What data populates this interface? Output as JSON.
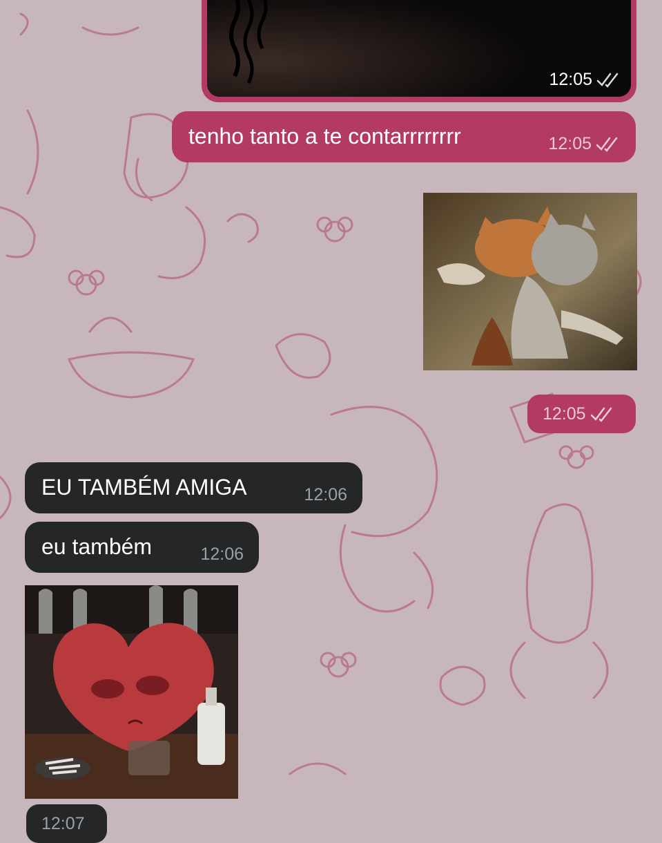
{
  "theme": {
    "outgoing": "#b23a65",
    "incoming": "#242627",
    "wallpaper": "#c8b6bd",
    "wallpaper_art": "#b4677f"
  },
  "messages": [
    {
      "id": "m1",
      "direction": "outgoing",
      "kind": "video",
      "time": "12:05",
      "status": "read"
    },
    {
      "id": "m2",
      "direction": "outgoing",
      "kind": "text",
      "text": "tenho tanto a te contarrrrrrrr",
      "time": "12:05",
      "status": "read"
    },
    {
      "id": "m3",
      "direction": "outgoing",
      "kind": "gif",
      "subject": "two cats hugging",
      "time": "12:05",
      "status": "read"
    },
    {
      "id": "m4",
      "direction": "incoming",
      "kind": "text",
      "text": "EU TAMBÉM AMIGA",
      "time": "12:06"
    },
    {
      "id": "m5",
      "direction": "incoming",
      "kind": "text",
      "text": "eu também",
      "time": "12:06"
    },
    {
      "id": "m6",
      "direction": "incoming",
      "kind": "gif",
      "subject": "sad cartoon heart at bar",
      "time": "12:07"
    }
  ]
}
